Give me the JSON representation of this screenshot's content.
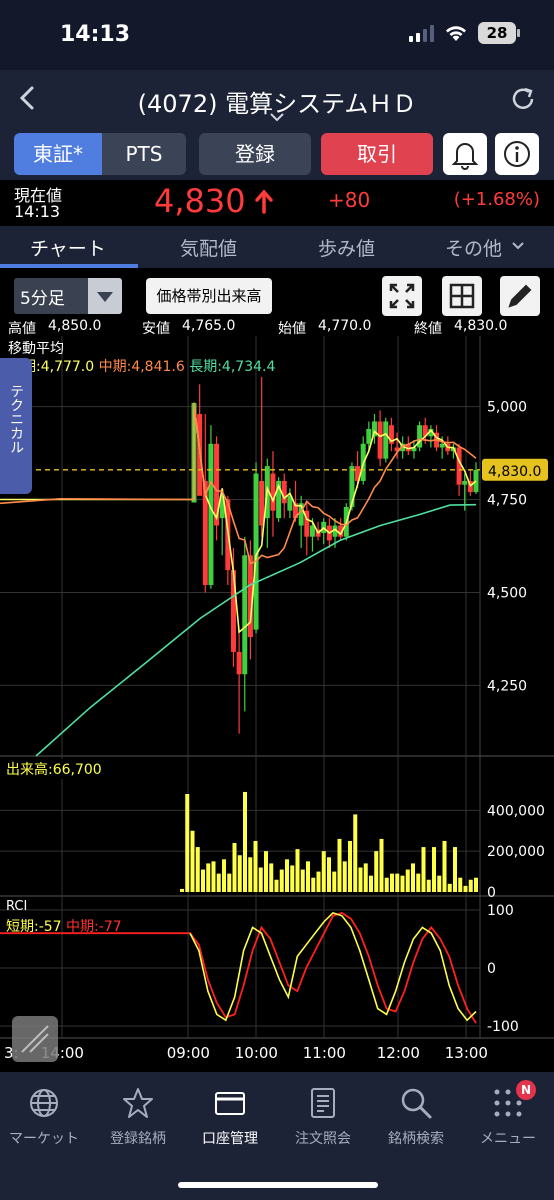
{
  "status": {
    "time": "14:13",
    "battery": "28"
  },
  "header": {
    "title": "(4072) 電算システムＨＤ"
  },
  "buttons": {
    "seg_tse": "東証*",
    "seg_pts": "PTS",
    "register": "登録",
    "trade": "取引"
  },
  "price": {
    "label": "現在値",
    "time": "14:13",
    "value": "4,830",
    "change": "+80",
    "change_pct": "(+1.68%)",
    "color_up": "#ff3b3b"
  },
  "tabs": [
    {
      "label": "チャート"
    },
    {
      "label": "気配値"
    },
    {
      "label": "歩み値"
    },
    {
      "label": "その他"
    }
  ],
  "toolbar": {
    "interval": "5分足",
    "volume_by_price": "価格帯別出来高",
    "ohlc": {
      "high_label": "高値",
      "high": "4,850.0",
      "low_label": "安値",
      "low": "4,765.0",
      "open_label": "始値",
      "open": "4,770.0",
      "close_label": "終値",
      "close": "4,830.0"
    }
  },
  "chart_overlay": {
    "technical_tab": "テクニカル",
    "ma_title": "移動平均",
    "ma_short": "短期:4,777.0",
    "ma_mid": "中期:4,841.6",
    "ma_long": "長期:4,734.4",
    "volume_label": "出来高:66,700",
    "rci_title": "RCI",
    "rci_short": "短期:-57",
    "rci_mid": "中期:-77"
  },
  "chart_data": {
    "type": "candlestick",
    "x_ticks": [
      "3:",
      "14:00",
      "09:00",
      "10:00",
      "11:00",
      "12:00",
      "13:00",
      "14:00"
    ],
    "price_axis": {
      "ticks": [
        "5,000",
        "4,750",
        "4,500",
        "4,250"
      ],
      "current_label": "4,830.0",
      "current": 4830,
      "range": [
        4060,
        5190
      ]
    },
    "volume_axis": {
      "ticks": [
        "400,000",
        "200,000",
        "0"
      ]
    },
    "rci_axis": {
      "ticks": [
        "100",
        "0",
        "-100"
      ]
    },
    "colors": {
      "up": "#3fcf3f",
      "down": "#ff3b3b",
      "ma_short": "#ffff66",
      "ma_mid": "#ff8a4a",
      "ma_long": "#4fe0a0",
      "volume": "#ffff4a",
      "rci_short": "#ffff4a",
      "rci_mid": "#ff2020"
    },
    "candles": [
      [
        4742,
        4760,
        4742,
        5010,
        "up"
      ],
      [
        4980,
        5060,
        4960,
        4760,
        "down"
      ],
      [
        4800,
        4980,
        4500,
        4520,
        "down"
      ],
      [
        4520,
        4950,
        4510,
        4900,
        "up"
      ],
      [
        4900,
        4920,
        4640,
        4680,
        "down"
      ],
      [
        4700,
        4780,
        4600,
        4760,
        "up"
      ],
      [
        4750,
        4760,
        4520,
        4560,
        "down"
      ],
      [
        4560,
        4620,
        4300,
        4340,
        "down"
      ],
      [
        4340,
        4390,
        4120,
        4280,
        "down"
      ],
      [
        4280,
        4650,
        4180,
        4600,
        "up"
      ],
      [
        4600,
        4640,
        4320,
        4380,
        "down"
      ],
      [
        4400,
        4850,
        4390,
        4820,
        "up"
      ],
      [
        4800,
        5080,
        4650,
        4680,
        "down"
      ],
      [
        4700,
        4860,
        4620,
        4840,
        "up"
      ],
      [
        4820,
        4880,
        4650,
        4720,
        "down"
      ],
      [
        4700,
        4810,
        4690,
        4800,
        "up"
      ],
      [
        4800,
        4820,
        4700,
        4740,
        "down"
      ],
      [
        4720,
        4780,
        4700,
        4760,
        "up"
      ],
      [
        4740,
        4800,
        4690,
        4700,
        "down"
      ],
      [
        4680,
        4760,
        4620,
        4740,
        "up"
      ],
      [
        4720,
        4740,
        4600,
        4650,
        "down"
      ],
      [
        4650,
        4700,
        4610,
        4680,
        "up"
      ],
      [
        4670,
        4690,
        4640,
        4650,
        "down"
      ],
      [
        4660,
        4700,
        4630,
        4690,
        "up"
      ],
      [
        4680,
        4700,
        4620,
        4640,
        "down"
      ],
      [
        4650,
        4700,
        4620,
        4680,
        "up"
      ],
      [
        4680,
        4700,
        4640,
        4650,
        "down"
      ],
      [
        4650,
        4740,
        4640,
        4730,
        "up"
      ],
      [
        4730,
        4850,
        4720,
        4840,
        "up"
      ],
      [
        4840,
        4880,
        4780,
        4800,
        "down"
      ],
      [
        4800,
        4920,
        4790,
        4900,
        "up"
      ],
      [
        4900,
        4960,
        4880,
        4940,
        "up"
      ],
      [
        4920,
        4980,
        4900,
        4960,
        "up"
      ],
      [
        4960,
        4990,
        4840,
        4860,
        "down"
      ],
      [
        4860,
        4970,
        4850,
        4960,
        "up"
      ],
      [
        4950,
        4970,
        4880,
        4900,
        "down"
      ],
      [
        4890,
        4930,
        4860,
        4880,
        "down"
      ],
      [
        4880,
        4920,
        4860,
        4900,
        "up"
      ],
      [
        4900,
        4920,
        4870,
        4880,
        "down"
      ],
      [
        4880,
        4910,
        4860,
        4890,
        "up"
      ],
      [
        4890,
        4960,
        4880,
        4950,
        "up"
      ],
      [
        4950,
        4970,
        4900,
        4920,
        "down"
      ],
      [
        4920,
        4950,
        4890,
        4940,
        "up"
      ],
      [
        4930,
        4950,
        4880,
        4890,
        "down"
      ],
      [
        4890,
        4920,
        4860,
        4900,
        "up"
      ],
      [
        4900,
        4920,
        4870,
        4880,
        "down"
      ],
      [
        4880,
        4900,
        4860,
        4890,
        "up"
      ],
      [
        4890,
        4900,
        4760,
        4790,
        "down"
      ],
      [
        4790,
        4820,
        4720,
        4800,
        "up"
      ],
      [
        4800,
        4830,
        4760,
        4770,
        "down"
      ],
      [
        4770,
        4850,
        4765,
        4830,
        "up"
      ]
    ],
    "volumes": [
      15000,
      480000,
      300000,
      220000,
      110000,
      140000,
      150000,
      90000,
      160000,
      90000,
      240000,
      180000,
      490000,
      170000,
      250000,
      120000,
      200000,
      140000,
      60000,
      110000,
      160000,
      130000,
      210000,
      110000,
      150000,
      70000,
      100000,
      200000,
      170000,
      100000,
      260000,
      150000,
      250000,
      380000,
      120000,
      140000,
      80000,
      200000,
      260000,
      70000,
      90000,
      90000,
      80000,
      110000,
      140000,
      90000,
      220000,
      60000,
      220000,
      80000,
      250000,
      40000,
      220000,
      70000,
      30000,
      60000,
      70000
    ],
    "rci_short": [
      60,
      30,
      -40,
      -80,
      -90,
      -50,
      30,
      70,
      60,
      20,
      -20,
      -50,
      20,
      40,
      60,
      80,
      95,
      90,
      70,
      30,
      -20,
      -70,
      -80,
      -40,
      10,
      50,
      70,
      60,
      30,
      -30,
      -70,
      -90,
      -75
    ],
    "rci_mid": [
      60,
      40,
      -20,
      -60,
      -85,
      -80,
      -30,
      30,
      70,
      50,
      10,
      -30,
      -40,
      0,
      30,
      60,
      90,
      95,
      85,
      60,
      20,
      -30,
      -70,
      -75,
      -40,
      10,
      50,
      70,
      50,
      20,
      -30,
      -70,
      -95
    ]
  },
  "nav": [
    {
      "label": "マーケット"
    },
    {
      "label": "登録銘柄"
    },
    {
      "label": "口座管理"
    },
    {
      "label": "注文照会"
    },
    {
      "label": "銘柄検索"
    },
    {
      "label": "メニュー",
      "badge": "N"
    }
  ]
}
